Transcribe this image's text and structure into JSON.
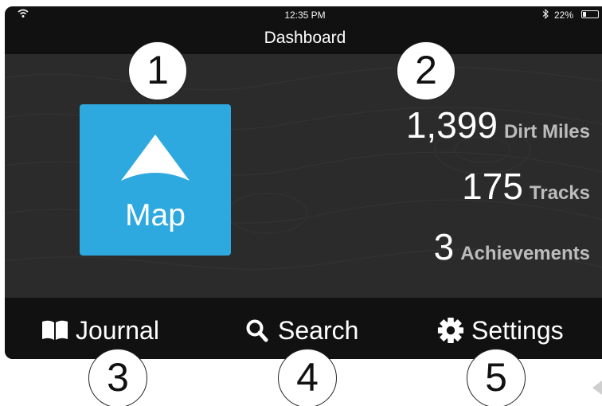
{
  "status_bar": {
    "time": "12:35 PM",
    "battery_percent": "22%",
    "battery_level": 0.22,
    "icons": [
      "wifi-icon",
      "bluetooth-icon",
      "battery-icon"
    ]
  },
  "title_bar": {
    "title": "Dashboard"
  },
  "map_tile": {
    "label": "Map",
    "icon": "navigation-arrow-icon",
    "color": "#2ea9df"
  },
  "stats": [
    {
      "value": "1,399",
      "label": "Dirt Miles"
    },
    {
      "value": "175",
      "label": "Tracks"
    },
    {
      "value": "3",
      "label": "Achievements"
    }
  ],
  "bottom_nav": [
    {
      "label": "Journal",
      "icon": "book-icon"
    },
    {
      "label": "Search",
      "icon": "search-icon"
    },
    {
      "label": "Settings",
      "icon": "gear-icon"
    }
  ],
  "callouts": [
    "1",
    "2",
    "3",
    "4",
    "5"
  ],
  "colors": {
    "background": "#2b2b2b",
    "bars": "#111111",
    "accent": "#2ea9df",
    "stat_label": "#bcbcbc"
  }
}
